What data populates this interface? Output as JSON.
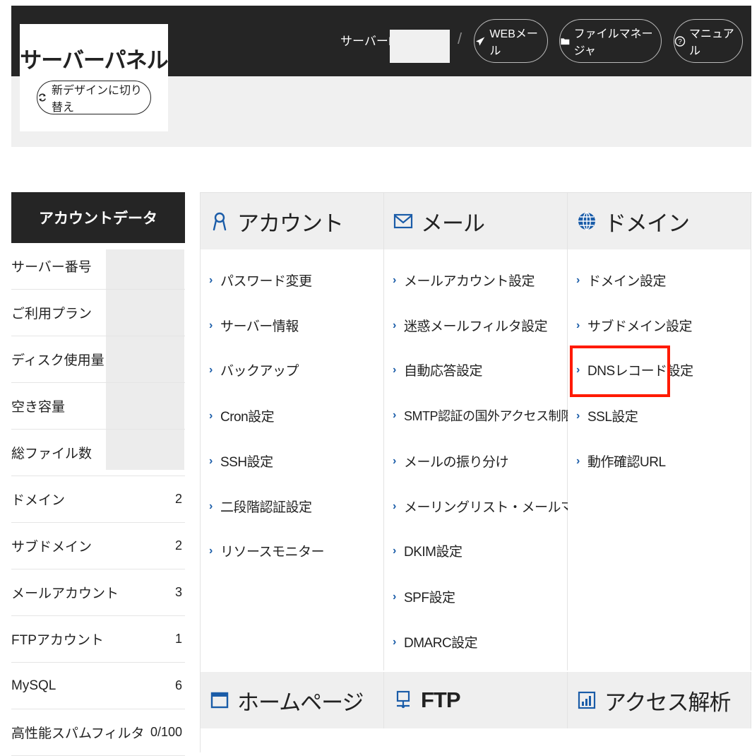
{
  "header": {
    "logo_title": "サーバーパネル",
    "switch_label": "新デザインに切り替え",
    "server_id_label": "サーバーID",
    "buttons": {
      "webmail": "WEBメール",
      "file_manager": "ファイルマネージャ",
      "manual": "マニュアル"
    }
  },
  "sidebar": {
    "title": "アカウントデータ",
    "rows": [
      {
        "label": "サーバー番号",
        "value": ""
      },
      {
        "label": "ご利用プラン",
        "value": ""
      },
      {
        "label": "ディスク使用量",
        "value": ""
      },
      {
        "label": "空き容量",
        "value": ""
      },
      {
        "label": "総ファイル数",
        "value": ""
      },
      {
        "label": "ドメイン",
        "value": "2"
      },
      {
        "label": "サブドメイン",
        "value": "2"
      },
      {
        "label": "メールアカウント",
        "value": "3"
      },
      {
        "label": "FTPアカウント",
        "value": "1"
      },
      {
        "label": "MySQL",
        "value": "6"
      },
      {
        "label": "高性能スパムフィルタ",
        "value": "0/100"
      }
    ]
  },
  "sections": {
    "account": {
      "title": "アカウント",
      "icon": "user-icon",
      "items": [
        "パスワード変更",
        "サーバー情報",
        "バックアップ",
        "Cron設定",
        "SSH設定",
        "二段階認証設定",
        "リソースモニター"
      ]
    },
    "mail": {
      "title": "メール",
      "icon": "mail-icon",
      "items": [
        "メールアカウント設定",
        "迷惑メールフィルタ設定",
        "自動応答設定",
        "SMTP認証の国外アクセス制限設定",
        "メールの振り分け",
        "メーリングリスト・メールマガジン",
        "DKIM設定",
        "SPF設定",
        "DMARC設定"
      ]
    },
    "domain": {
      "title": "ドメイン",
      "icon": "globe-icon",
      "items": [
        "ドメイン設定",
        "サブドメイン設定",
        "DNSレコード設定",
        "SSL設定",
        "動作確認URL"
      ]
    },
    "homepage": {
      "title": "ホームページ",
      "icon": "window-icon"
    },
    "ftp": {
      "title": "FTP",
      "icon": "monitor-network-icon"
    },
    "access": {
      "title": "アクセス解析",
      "icon": "bar-chart-icon"
    }
  },
  "colors": {
    "header_bg": "#252525",
    "link_arrow": "#1a5ca8",
    "highlight": "#ff1a00",
    "icon_blue": "#1a5ca8"
  }
}
